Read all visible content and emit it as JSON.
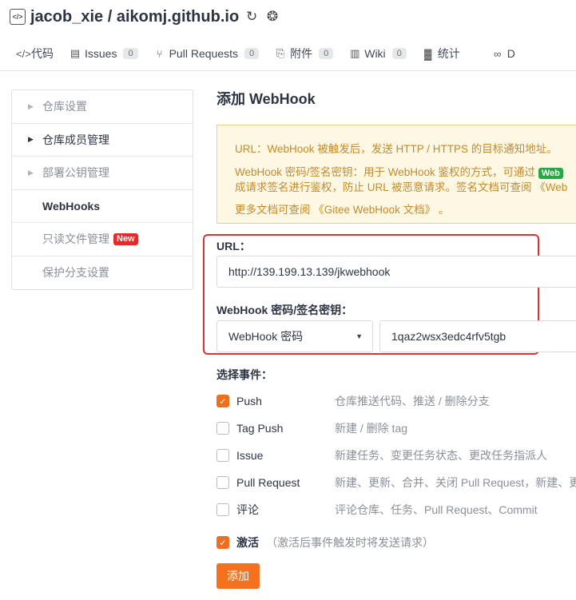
{
  "header": {
    "title": "jacob_xie / aikomj.github.io",
    "repo_icon": "code-repo-icon",
    "tabs": [
      {
        "icon": "code-icon",
        "label": "代码",
        "count": null
      },
      {
        "icon": "issues-icon",
        "label": "Issues",
        "count": "0"
      },
      {
        "icon": "pull-request-icon",
        "label": "Pull Requests",
        "count": "0"
      },
      {
        "icon": "attachment-icon",
        "label": "附件",
        "count": "0"
      },
      {
        "icon": "wiki-icon",
        "label": "Wiki",
        "count": "0"
      },
      {
        "icon": "stats-icon",
        "label": "统计",
        "count": null
      },
      {
        "icon": "devops-icon",
        "label": "D",
        "count": null
      }
    ]
  },
  "sidebar": {
    "items": [
      {
        "label": "仓库设置"
      },
      {
        "label": "仓库成员管理"
      },
      {
        "label": "部署公钥管理"
      },
      {
        "label": "WebHooks"
      },
      {
        "label": "只读文件管理",
        "badge": "New"
      },
      {
        "label": "保护分支设置"
      }
    ]
  },
  "main": {
    "title": "添加 WebHook",
    "notice": {
      "line1": "URL：WebHook 被触发后，发送 HTTP / HTTPS 的目标通知地址。",
      "line2": "WebHook 密码/签名密钥：用于 WebHook 鉴权的方式，可通过",
      "line2_chip": "Web",
      "line3": "成请求签名进行鉴权，防止 URL 被恶意请求。签名文档可查阅",
      "line3_link": "《Web",
      "line4": "更多文档可查阅",
      "line4_link": "《Gitee WebHook 文档》",
      "line4_end": "。"
    },
    "url_label": "URL：",
    "url_value": "http://139.199.13.139/jkwebhook",
    "secret_label": "WebHook 密码/签名密钥：",
    "secret_type": "WebHook 密码",
    "secret_value": "1qaz2wsx3edc4rfv5tgb",
    "events_title": "选择事件：",
    "events": [
      {
        "name": "Push",
        "desc": "仓库推送代码、推送 / 删除分支",
        "checked": true
      },
      {
        "name": "Tag Push",
        "desc": "新建 / 删除 tag",
        "checked": false
      },
      {
        "name": "Issue",
        "desc": "新建任务、变更任务状态、更改任务指派人",
        "checked": false
      },
      {
        "name": "Pull Request",
        "desc": "新建、更新、合并、关闭 Pull Request，新建、更",
        "checked": false
      },
      {
        "name": "评论",
        "desc": "评论仓库、任务、Pull Request、Commit",
        "checked": false
      }
    ],
    "activate_label": "激活",
    "activate_hint": "（激活后事件触发时将发送请求）",
    "activate_checked": true,
    "add_button": "添加"
  },
  "colors": {
    "accent": "#f4711d",
    "notice_bg": "#fdf8e3",
    "notice_text": "#c8892a",
    "highlight_box": "#e1302d",
    "new_badge": "#e02c2c"
  }
}
